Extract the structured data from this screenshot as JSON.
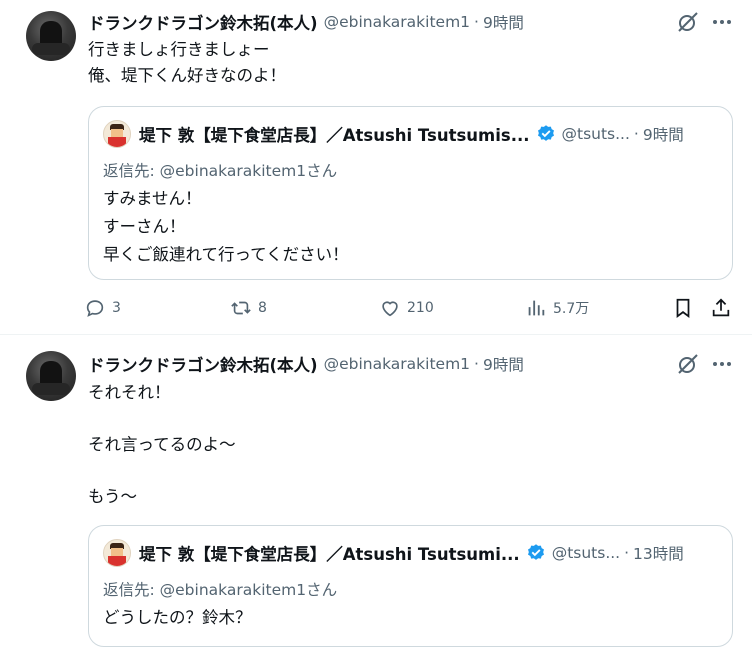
{
  "tweets": [
    {
      "author": {
        "name": "ドランクドラゴン鈴木拓(本人)",
        "handle": "@ebinakarakitem1",
        "dot": "·",
        "time": "9時間"
      },
      "text": [
        "行きましょ行きましょー",
        "俺、堤下くん好きなのよ！"
      ],
      "quote": {
        "author": {
          "name": "堤下 敦【堤下食堂店長】／Atsushi Tsutsumis...",
          "handle": "@tsuts...",
          "dot": "·",
          "time": "9時間"
        },
        "reply_to": "返信先: @ebinakarakitem1さん",
        "text": [
          "すみません！",
          "すーさん！",
          "早くご飯連れて行ってください！"
        ]
      },
      "actions": {
        "replies": "3",
        "retweets": "8",
        "likes": "210",
        "views": "5.7万"
      }
    },
    {
      "author": {
        "name": "ドランクドラゴン鈴木拓(本人)",
        "handle": "@ebinakarakitem1",
        "dot": "·",
        "time": "9時間"
      },
      "text": [
        "それそれ！",
        "",
        "それ言ってるのよ〜",
        "",
        "もう〜"
      ],
      "quote": {
        "author": {
          "name": "堤下 敦【堤下食堂店長】／Atsushi Tsutsumi...",
          "handle": "@tsuts...",
          "dot": "·",
          "time": "13時間"
        },
        "reply_to": "返信先: @ebinakarakitem1さん",
        "text": [
          "どうしたの？鈴木？"
        ]
      }
    }
  ],
  "colors": {
    "verified": "#1d9bf0",
    "text": "#0f1419",
    "secondary": "#536471",
    "border": "#cfd9de"
  },
  "icons": [
    "grok-icon",
    "more-icon",
    "reply-icon",
    "retweet-icon",
    "like-icon",
    "views-icon",
    "bookmark-icon",
    "share-icon",
    "verified-badge-icon"
  ]
}
